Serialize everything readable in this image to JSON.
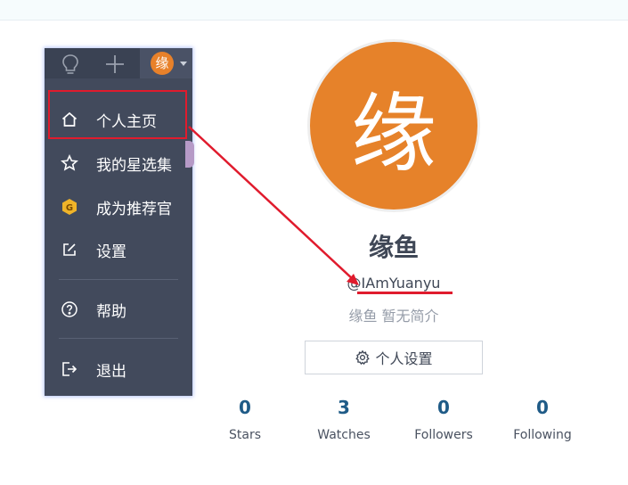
{
  "header": {
    "bulb_icon": "lightbulb-icon",
    "plus_icon": "plus-icon",
    "avatar_char": "缘"
  },
  "menu": {
    "items": [
      {
        "label": "个人主页",
        "icon": "home-icon"
      },
      {
        "label": "我的星选集",
        "icon": "star-icon"
      },
      {
        "label": "成为推荐官",
        "icon": "badge-icon"
      },
      {
        "label": "设置",
        "icon": "edit-icon"
      },
      {
        "label": "帮助",
        "icon": "help-icon"
      },
      {
        "label": "退出",
        "icon": "logout-icon"
      }
    ]
  },
  "profile": {
    "avatar_char": "缘",
    "name": "缘鱼",
    "username": "@IAmYuanyu",
    "bio": "缘鱼 暂无简介",
    "settings_button": "个人设置"
  },
  "stats": [
    {
      "value": "0",
      "label": "Stars"
    },
    {
      "value": "3",
      "label": "Watches"
    },
    {
      "value": "0",
      "label": "Followers"
    },
    {
      "value": "0",
      "label": "Following"
    }
  ],
  "colors": {
    "menu_bg": "#424a5c",
    "avatar_orange": "#e6822a",
    "annotation_red": "#e01b2d",
    "stat_number": "#1f5b87"
  }
}
